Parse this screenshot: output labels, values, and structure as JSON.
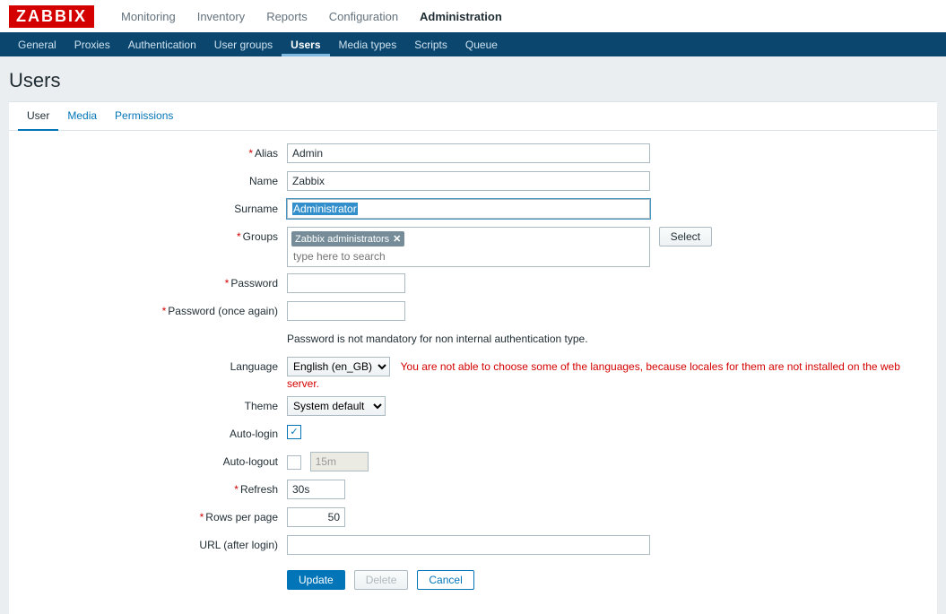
{
  "logo": "ZABBIX",
  "topnav": [
    "Monitoring",
    "Inventory",
    "Reports",
    "Configuration",
    "Administration"
  ],
  "topnav_active": 4,
  "subnav": [
    "General",
    "Proxies",
    "Authentication",
    "User groups",
    "Users",
    "Media types",
    "Scripts",
    "Queue"
  ],
  "subnav_active": 4,
  "page_title": "Users",
  "tabs": [
    "User",
    "Media",
    "Permissions"
  ],
  "tabs_active": 0,
  "labels": {
    "alias": "Alias",
    "name": "Name",
    "surname": "Surname",
    "groups": "Groups",
    "password": "Password",
    "password_again": "Password (once again)",
    "language": "Language",
    "theme": "Theme",
    "auto_login": "Auto-login",
    "auto_logout": "Auto-logout",
    "refresh": "Refresh",
    "rows": "Rows per page",
    "url": "URL (after login)"
  },
  "values": {
    "alias": "Admin",
    "name": "Zabbix",
    "surname": "Administrator",
    "group_tag": "Zabbix administrators",
    "group_placeholder": "type here to search",
    "password_hint": "Password is not mandatory for non internal authentication type.",
    "language": "English (en_GB)",
    "language_warn": "You are not able to choose some of the languages, because locales for them are not installed on the web server.",
    "theme": "System default",
    "auto_login_checked": true,
    "auto_logout_checked": false,
    "auto_logout_value": "15m",
    "refresh": "30s",
    "rows": "50",
    "url": ""
  },
  "buttons": {
    "select": "Select",
    "update": "Update",
    "delete": "Delete",
    "cancel": "Cancel"
  }
}
